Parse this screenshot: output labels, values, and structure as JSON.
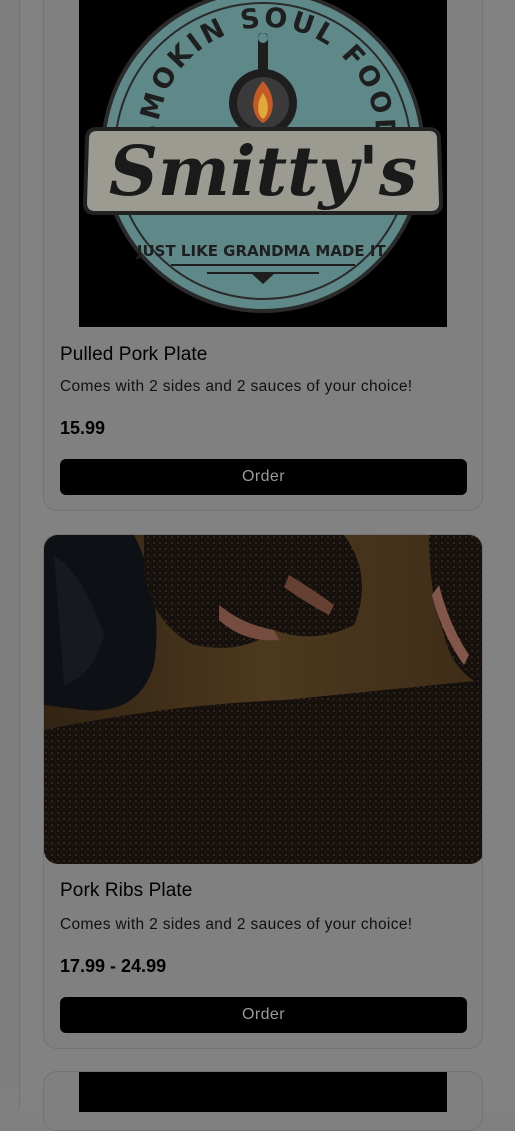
{
  "menu": {
    "items": [
      {
        "name": "Pulled Pork Plate",
        "description": "Comes with 2 sides and 2 sauces of your choice!",
        "price": "15.99",
        "order_label": "Order",
        "image": {
          "type": "logo",
          "top_arc": "SMOKIN SOUL FOOD",
          "script": "Smitty's",
          "tagline": "JUST LIKE GRANDMA MADE IT."
        }
      },
      {
        "name": "Pork Ribs Plate",
        "description": "Comes with 2 sides and 2 sauces of your choice!",
        "price": "17.99 - 24.99",
        "order_label": "Order",
        "image": {
          "type": "photo",
          "subject": "smoked pork ribs on cutting board"
        }
      }
    ]
  },
  "colors": {
    "page_dim": "#808080",
    "button_bg": "#000000",
    "button_text": "#9a9a9a",
    "logo_teal": "#5f8a88",
    "logo_cream": "#9e9d92"
  }
}
